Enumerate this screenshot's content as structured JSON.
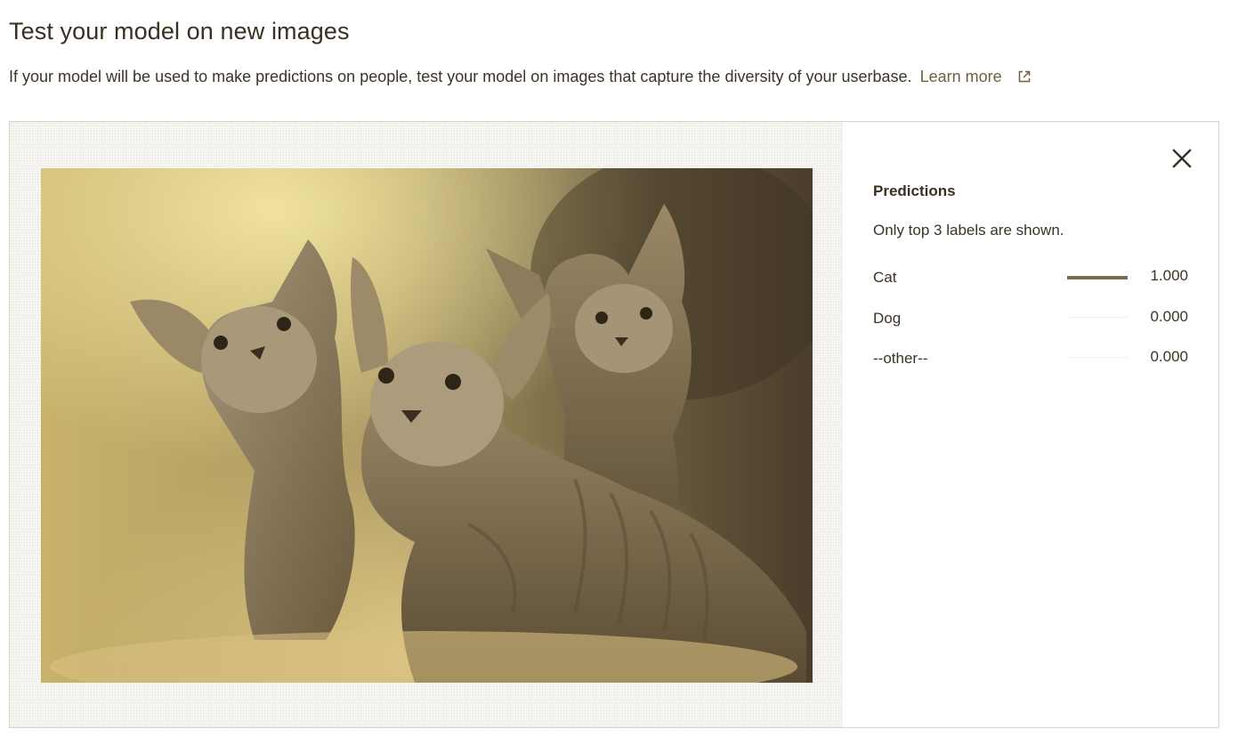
{
  "header": {
    "title": "Test your model on new images",
    "description": "If your model will be used to make predictions on people, test your model on images that capture the diversity of your userbase.",
    "learn_more_label": "Learn more"
  },
  "icons": {
    "external_link": "external-link-icon",
    "close": "close-icon"
  },
  "colors": {
    "accent": "#7d6d4d",
    "link": "#6d5f3f",
    "text": "#3c3424"
  },
  "predictions": {
    "title": "Predictions",
    "note": "Only top 3 labels are shown.",
    "items": [
      {
        "label": "Cat",
        "score": "1.000",
        "value": 1.0
      },
      {
        "label": "Dog",
        "score": "0.000",
        "value": 0.0
      },
      {
        "label": "--other--",
        "score": "0.000",
        "value": 0.0
      }
    ]
  }
}
